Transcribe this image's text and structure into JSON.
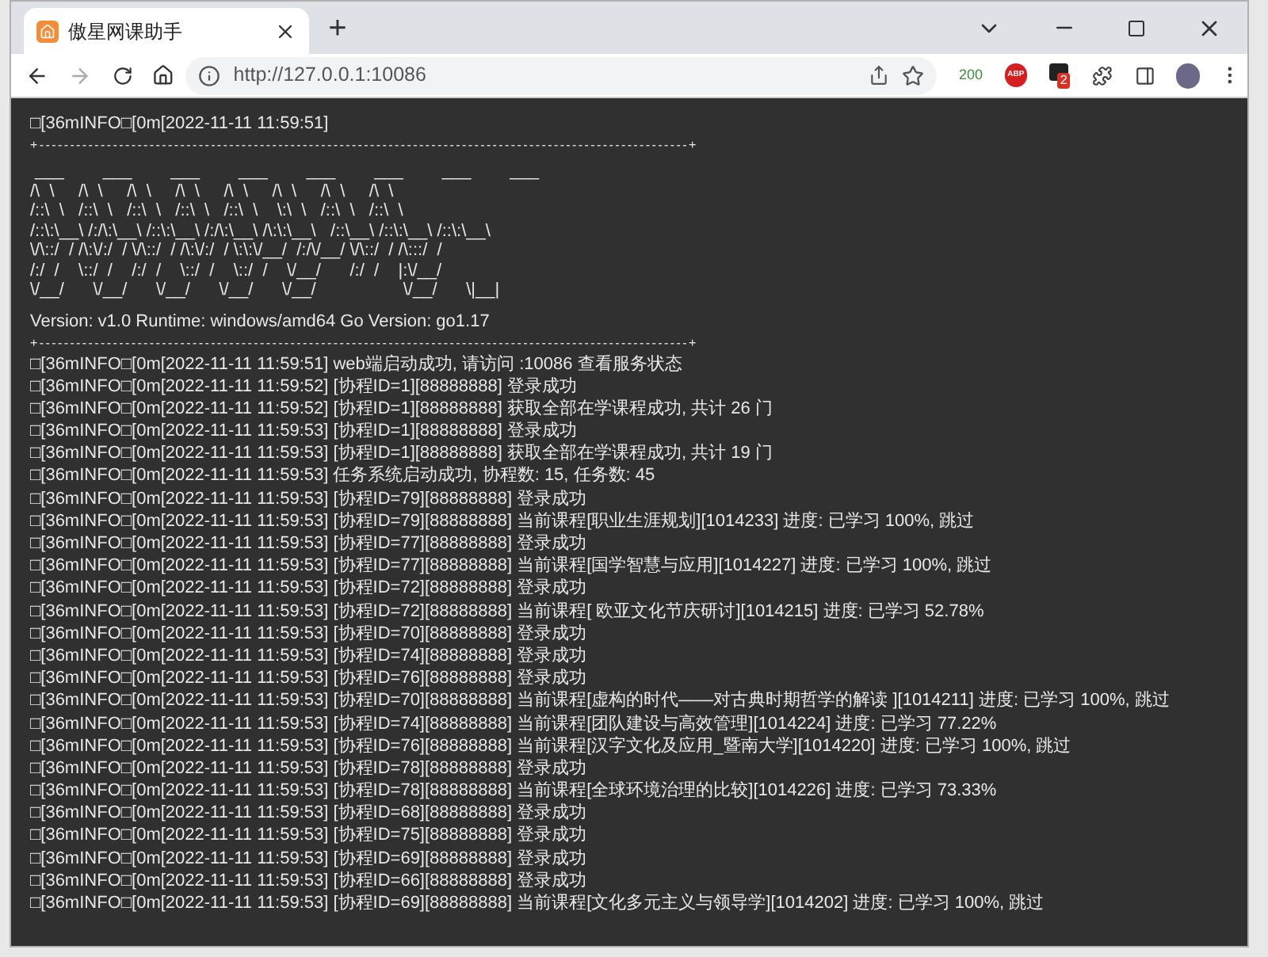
{
  "tab": {
    "title": "傲星网课助手",
    "selected": true
  },
  "window_controls": {
    "new_tab": "+"
  },
  "address_bar": {
    "url": "http://127.0.0.1:10086"
  },
  "extensions": {
    "counter": "200",
    "abp": "ABP",
    "badge": "2"
  },
  "console": {
    "header": "□[36mINFO□[0m[2022-11-11 11:59:51]",
    "rule_top": "+----------------------------------------------------------------------------------------------------------+",
    "art": [
      " ___        ___        ___        ___        ___        ___        ___        ___",
      "/\\  \\     /\\  \\     /\\  \\     /\\  \\     /\\  \\     /\\  \\     /\\  \\     /\\  \\",
      "/::\\  \\   /::\\  \\   /::\\  \\   /::\\  \\   /::\\  \\    \\:\\  \\   /::\\  \\   /::\\  \\",
      "/::\\:\\__\\ /:/\\:\\__\\ /::\\:\\__\\ /:/\\:\\__\\ /\\:\\:\\__\\   /::\\__\\ /::\\:\\__\\ /::\\:\\__\\",
      "\\/\\::/  / /\\:\\/:/  / \\/\\::/  / /\\:\\/:/  / \\:\\:\\/__/  /:/\\/__/ \\/\\::/  / /\\:::/  /",
      "/:/  /    \\::/  /    /:/  /    \\::/  /    \\::/  /    \\/__/      /:/  /    |:\\/__/",
      "\\/__/      \\/__/      \\/__/      \\/__/      \\/__/                  \\/__/      \\|__|"
    ],
    "version": "Version: v1.0 Runtime: windows/amd64 Go Version: go1.17",
    "rule_bottom": "+----------------------------------------------------------------------------------------------------------+",
    "log": [
      "□[36mINFO□[0m[2022-11-11 11:59:51] web端启动成功, 请访问 :10086 查看服务状态",
      "□[36mINFO□[0m[2022-11-11 11:59:52] [协程ID=1][88888888] 登录成功",
      "□[36mINFO□[0m[2022-11-11 11:59:52] [协程ID=1][88888888] 获取全部在学课程成功, 共计 26 门",
      "□[36mINFO□[0m[2022-11-11 11:59:53] [协程ID=1][88888888] 登录成功",
      "□[36mINFO□[0m[2022-11-11 11:59:53] [协程ID=1][88888888] 获取全部在学课程成功, 共计 19 门",
      "□[36mINFO□[0m[2022-11-11 11:59:53] 任务系统启动成功, 协程数: 15, 任务数: 45",
      "□[36mINFO□[0m[2022-11-11 11:59:53] [协程ID=79][88888888] 登录成功",
      "□[36mINFO□[0m[2022-11-11 11:59:53] [协程ID=79][88888888] 当前课程[职业生涯规划][1014233] 进度: 已学习 100%, 跳过",
      "□[36mINFO□[0m[2022-11-11 11:59:53] [协程ID=77][88888888] 登录成功",
      "□[36mINFO□[0m[2022-11-11 11:59:53] [协程ID=77][88888888] 当前课程[国学智慧与应用][1014227] 进度: 已学习 100%, 跳过",
      "□[36mINFO□[0m[2022-11-11 11:59:53] [协程ID=72][88888888] 登录成功",
      "□[36mINFO□[0m[2022-11-11 11:59:53] [协程ID=72][88888888] 当前课程[ 欧亚文化节庆研讨][1014215] 进度: 已学习 52.78%",
      "□[36mINFO□[0m[2022-11-11 11:59:53] [协程ID=70][88888888] 登录成功",
      "□[36mINFO□[0m[2022-11-11 11:59:53] [协程ID=74][88888888] 登录成功",
      "□[36mINFO□[0m[2022-11-11 11:59:53] [协程ID=76][88888888] 登录成功",
      "□[36mINFO□[0m[2022-11-11 11:59:53] [协程ID=70][88888888] 当前课程[虚构的时代——对古典时期哲学的解读 ][1014211] 进度: 已学习 100%, 跳过",
      "□[36mINFO□[0m[2022-11-11 11:59:53] [协程ID=74][88888888] 当前课程[团队建设与高效管理][1014224] 进度: 已学习 77.22%",
      "□[36mINFO□[0m[2022-11-11 11:59:53] [协程ID=76][88888888] 当前课程[汉字文化及应用_暨南大学][1014220] 进度: 已学习 100%, 跳过",
      "□[36mINFO□[0m[2022-11-11 11:59:53] [协程ID=78][88888888] 登录成功",
      "□[36mINFO□[0m[2022-11-11 11:59:53] [协程ID=78][88888888] 当前课程[全球环境治理的比较][1014226] 进度: 已学习 73.33%",
      "□[36mINFO□[0m[2022-11-11 11:59:53] [协程ID=68][88888888] 登录成功",
      "□[36mINFO□[0m[2022-11-11 11:59:53] [协程ID=75][88888888] 登录成功",
      "□[36mINFO□[0m[2022-11-11 11:59:53] [协程ID=69][88888888] 登录成功",
      "□[36mINFO□[0m[2022-11-11 11:59:53] [协程ID=66][88888888] 登录成功",
      "□[36mINFO□[0m[2022-11-11 11:59:53] [协程ID=69][88888888] 当前课程[文化多元主义与领导学][1014202] 进度: 已学习 100%, 跳过"
    ]
  }
}
